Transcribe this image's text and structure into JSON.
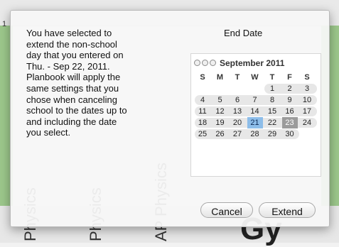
{
  "background": {
    "corner_number": "1",
    "vertical_texts": [
      "Physics",
      "Physics",
      "AP Physics"
    ],
    "big_text": "Gy"
  },
  "dialog": {
    "message": "You have selected to\nextend the non-school\nday that you entered on\nThu. - Sep 22, 2011.\nPlanbook will apply the\nsame settings that you\nchose when canceling\nschool to the dates up to\nand including the date\nyou select.",
    "end_date_title": "End Date",
    "calendar": {
      "month_label": "September 2011",
      "day_headers": [
        "S",
        "M",
        "T",
        "W",
        "T",
        "F",
        "S"
      ],
      "weeks": [
        [
          "",
          "",
          "",
          "",
          "1",
          "2",
          "3"
        ],
        [
          "4",
          "5",
          "6",
          "7",
          "8",
          "9",
          "10"
        ],
        [
          "11",
          "12",
          "13",
          "14",
          "15",
          "16",
          "17"
        ],
        [
          "18",
          "19",
          "20",
          "21",
          "22",
          "23",
          "24"
        ],
        [
          "25",
          "26",
          "27",
          "28",
          "29",
          "30",
          ""
        ]
      ],
      "selected_day": "21",
      "today_day": "23"
    },
    "cancel_label": "Cancel",
    "extend_label": "Extend"
  }
}
